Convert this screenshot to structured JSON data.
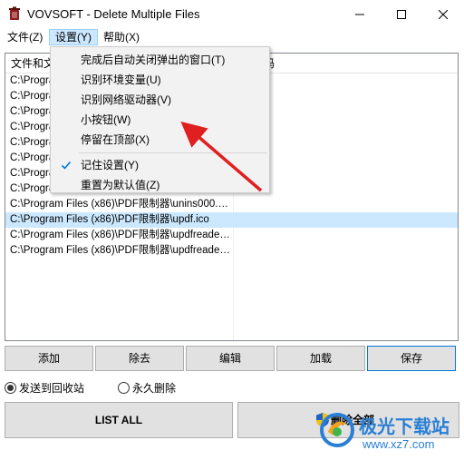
{
  "window": {
    "title": "VOVSOFT - Delete Multiple Files",
    "icon": "trash-bin-icon"
  },
  "menubar": {
    "file": "文件(Z)",
    "settings": "设置(Y)",
    "help": "帮助(X)"
  },
  "list": {
    "headers": [
      "文件和文",
      "码"
    ],
    "rows": [
      "C:\\Program",
      "C:\\Program",
      "C:\\Program",
      "C:\\Program",
      "C:\\Program",
      "C:\\Program",
      "C:\\Program",
      "C:\\Program",
      "C:\\Program Files (x86)\\PDF限制器\\unins000.exe",
      "C:\\Program Files (x86)\\PDF限制器\\updf.ico",
      "C:\\Program Files (x86)\\PDF限制器\\updfreader...",
      "C:\\Program Files (x86)\\PDF限制器\\updfreader..."
    ],
    "selected_index": 9
  },
  "dropdown": {
    "items": [
      "完成后自动关闭弹出的窗口(T)",
      "识别环境变量(U)",
      "识别网络驱动器(V)",
      "小按钮(W)",
      "停留在顶部(X)",
      "记住设置(Y)",
      "重置为默认值(Z)"
    ],
    "checked_item": "记住设置(Y)"
  },
  "buttons": {
    "add": "添加",
    "remove": "除去",
    "edit": "编辑",
    "load": "加载",
    "save": "保存"
  },
  "radio": {
    "recycle": "发送到回收站",
    "permanent": "永久删除",
    "selected": "recycle"
  },
  "actions": {
    "list_all": "LIST ALL",
    "delete_all": "删除全部"
  },
  "watermark": {
    "text": "极光下载站",
    "url": "www.xz7.com"
  },
  "colors": {
    "selection": "#cce8ff",
    "menu_highlight": "#cce8ff",
    "arrow": "#e02020",
    "check": "#0078d7",
    "watermark": "#2a7fd4"
  }
}
